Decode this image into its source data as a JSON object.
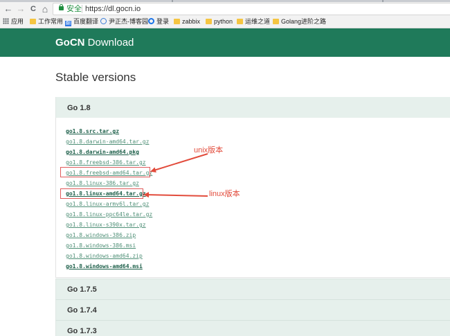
{
  "browser": {
    "nav": {
      "back": "←",
      "forward": "→",
      "reload": "C",
      "home": "⌂"
    },
    "security_label": "安全",
    "url": "https://dl.gocn.io",
    "bookmarks": [
      {
        "label": "应用",
        "icon": "apps-grid-icon"
      },
      {
        "label": "工作常用",
        "icon": "folder-icon"
      },
      {
        "label": "百度翻译",
        "icon": "baidu-translate-icon"
      },
      {
        "label": "尹正杰-博客园",
        "icon": "globe-icon"
      },
      {
        "label": "登录",
        "icon": "login-icon"
      },
      {
        "label": "zabbix",
        "icon": "folder-icon"
      },
      {
        "label": "python",
        "icon": "folder-icon"
      },
      {
        "label": "运维之道",
        "icon": "folder-icon"
      },
      {
        "label": "Golang进阶之路",
        "icon": "folder-icon"
      }
    ]
  },
  "site": {
    "brand_bold": "GoCN",
    "brand_rest": "Download",
    "header_color": "#1f7a5a"
  },
  "page": {
    "title": "Stable versions",
    "versions": [
      {
        "label": "Go 1.8",
        "expanded": true,
        "files": [
          "go1.8.src.tar.gz",
          "go1.8.darwin-amd64.tar.gz",
          "go1.8.darwin-amd64.pkg",
          "go1.8.freebsd-386.tar.gz",
          "go1.8.freebsd-amd64.tar.gz",
          "go1.8.linux-386.tar.gz",
          "go1.8.linux-amd64.tar.gz",
          "go1.8.linux-armv6l.tar.gz",
          "go1.8.linux-ppc64le.tar.gz",
          "go1.8.linux-s390x.tar.gz",
          "go1.8.windows-386.zip",
          "go1.8.windows-386.msi",
          "go1.8.windows-amd64.zip",
          "go1.8.windows-amd64.msi"
        ]
      },
      {
        "label": "Go 1.7.5",
        "expanded": false
      },
      {
        "label": "Go 1.7.4",
        "expanded": false
      },
      {
        "label": "Go 1.7.3",
        "expanded": false
      }
    ]
  },
  "annotations": {
    "unix": "unix版本",
    "linux": "linux版本",
    "color": "#e24b3b"
  }
}
